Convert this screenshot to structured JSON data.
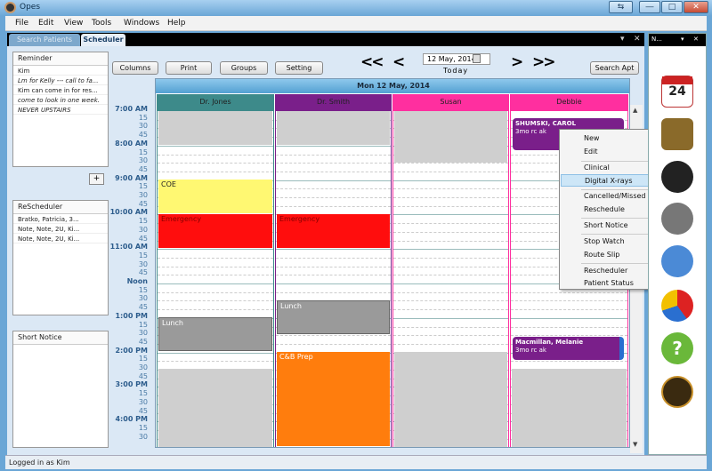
{
  "window": {
    "title": "Opes",
    "min_label": "―",
    "max_label": "□",
    "close_label": "✕",
    "back_label": "⇆"
  },
  "menu": [
    "File",
    "Edit",
    "View",
    "Tools",
    "Windows",
    "Help"
  ],
  "tabs": {
    "search": "Search Patients",
    "scheduler": "Scheduler",
    "pin": "▾",
    "close": "✕"
  },
  "reminder": {
    "title": "Reminder",
    "lines": [
      "Kim",
      "Lm for Kelly --- call to fa...",
      "Kim can come in for res...",
      "come to look in one week.",
      "NEVER UPSTAIRS"
    ],
    "add": "+"
  },
  "rescheduler": {
    "title": "ReScheduler",
    "lines": [
      "Bratko, Patricia, 3...",
      "Note, Note, 2U, Ki...",
      "Note, Note, 2U, Ki..."
    ]
  },
  "short_notice": {
    "title": "Short Notice"
  },
  "toolbar": {
    "columns": "Columns",
    "print": "Print",
    "groups": "Groups",
    "setting": "Setting",
    "search_apt": "Search Apt",
    "prev_week": "<<",
    "prev_day": "<",
    "next_day": ">",
    "next_week": ">>",
    "date": "12 May, 2014",
    "today": "Today"
  },
  "schedule": {
    "date_header": "Mon 12 May, 2014",
    "columns": [
      {
        "name": "Dr. Jones",
        "color": "#3d8a8a"
      },
      {
        "name": "Dr. Smith",
        "color": "#7a1f8a"
      },
      {
        "name": "Susan",
        "color": "#ff2f9f"
      },
      {
        "name": "Debbie",
        "color": "#ff2f9f"
      }
    ],
    "times": [
      "7:00 AM",
      "15",
      "30",
      "45",
      "8:00 AM",
      "15",
      "30",
      "45",
      "9:00 AM",
      "15",
      "30",
      "45",
      "10:00 AM",
      "15",
      "30",
      "45",
      "11:00 AM",
      "15",
      "30",
      "45",
      "Noon",
      "15",
      "30",
      "45",
      "1:00 PM",
      "15",
      "30",
      "45",
      "2:00 PM",
      "15",
      "30",
      "45",
      "3:00 PM",
      "15",
      "30",
      "45",
      "4:00 PM",
      "15",
      "30"
    ],
    "blocks": {
      "coe": "COE",
      "emergency1": "Emergency",
      "emergency2": "Emergency",
      "lunch1": "Lunch",
      "lunch2": "Lunch",
      "cb_prep": "C&B Prep"
    },
    "appointments": [
      {
        "name": "SHUMSKI, CAROL",
        "detail": "3mo rc ak"
      },
      {
        "name": "Macmillan, Melanie",
        "detail": "3mo rc ak"
      }
    ]
  },
  "context_menu": [
    "New",
    "Edit",
    "Clinical",
    "Digital X-rays",
    "Cancelled/Missed",
    "Reschedule",
    "Short Notice",
    "Stop Watch",
    "Route Slip",
    "Rescheduler",
    "Patient Status"
  ],
  "right_panel": {
    "title": "N...",
    "pin": "▾",
    "close": "✕",
    "calendar_day": "24"
  },
  "status": "Logged in as Kim"
}
